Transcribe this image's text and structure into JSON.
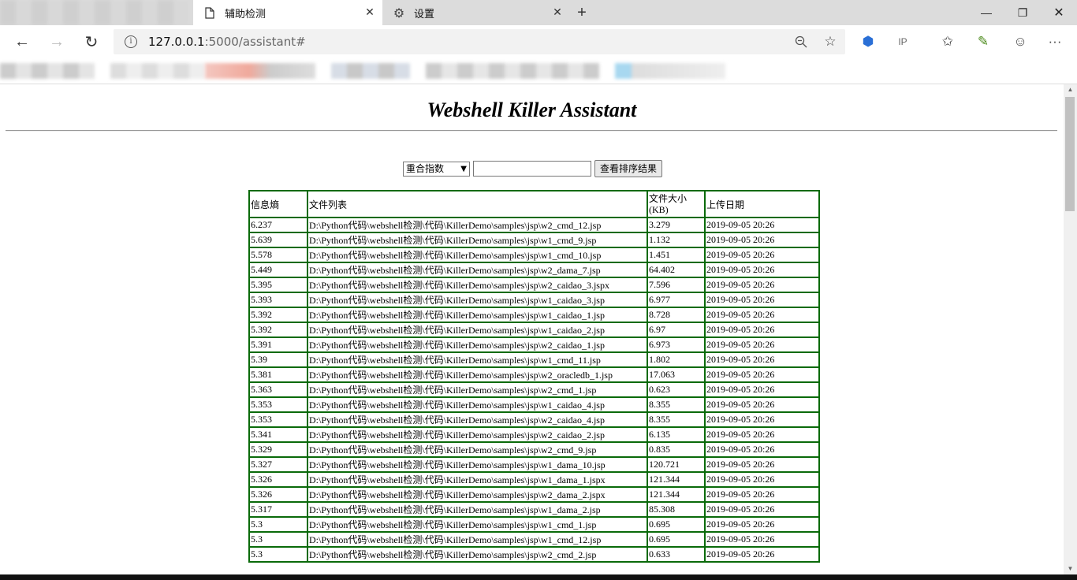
{
  "browser": {
    "tabs": [
      {
        "label": "辅助检测",
        "icon": "page-icon",
        "active": true
      },
      {
        "label": "设置",
        "icon": "gear-icon",
        "active": false
      }
    ],
    "url_host": "127.0.0.1",
    "url_rest": ":5000/assistant#"
  },
  "page": {
    "title": "Webshell Killer Assistant",
    "sort_select": {
      "selected": "重合指数"
    },
    "search_value": "",
    "view_button": "查看排序结果",
    "table": {
      "headers": [
        "信息熵",
        "文件列表",
        "文件大小(KB)",
        "上传日期"
      ],
      "rows": [
        [
          "6.237",
          "D:\\Python代码\\webshell检测\\代码\\KillerDemo\\samples\\jsp\\w2_cmd_12.jsp",
          "3.279",
          "2019-09-05 20:26"
        ],
        [
          "5.639",
          "D:\\Python代码\\webshell检测\\代码\\KillerDemo\\samples\\jsp\\w1_cmd_9.jsp",
          "1.132",
          "2019-09-05 20:26"
        ],
        [
          "5.578",
          "D:\\Python代码\\webshell检测\\代码\\KillerDemo\\samples\\jsp\\w1_cmd_10.jsp",
          "1.451",
          "2019-09-05 20:26"
        ],
        [
          "5.449",
          "D:\\Python代码\\webshell检测\\代码\\KillerDemo\\samples\\jsp\\w2_dama_7.jsp",
          "64.402",
          "2019-09-05 20:26"
        ],
        [
          "5.395",
          "D:\\Python代码\\webshell检测\\代码\\KillerDemo\\samples\\jsp\\w2_caidao_3.jspx",
          "7.596",
          "2019-09-05 20:26"
        ],
        [
          "5.393",
          "D:\\Python代码\\webshell检测\\代码\\KillerDemo\\samples\\jsp\\w1_caidao_3.jsp",
          "6.977",
          "2019-09-05 20:26"
        ],
        [
          "5.392",
          "D:\\Python代码\\webshell检测\\代码\\KillerDemo\\samples\\jsp\\w1_caidao_1.jsp",
          "8.728",
          "2019-09-05 20:26"
        ],
        [
          "5.392",
          "D:\\Python代码\\webshell检测\\代码\\KillerDemo\\samples\\jsp\\w1_caidao_2.jsp",
          "6.97",
          "2019-09-05 20:26"
        ],
        [
          "5.391",
          "D:\\Python代码\\webshell检测\\代码\\KillerDemo\\samples\\jsp\\w2_caidao_1.jsp",
          "6.973",
          "2019-09-05 20:26"
        ],
        [
          "5.39",
          "D:\\Python代码\\webshell检测\\代码\\KillerDemo\\samples\\jsp\\w1_cmd_11.jsp",
          "1.802",
          "2019-09-05 20:26"
        ],
        [
          "5.381",
          "D:\\Python代码\\webshell检测\\代码\\KillerDemo\\samples\\jsp\\w2_oracledb_1.jsp",
          "17.063",
          "2019-09-05 20:26"
        ],
        [
          "5.363",
          "D:\\Python代码\\webshell检测\\代码\\KillerDemo\\samples\\jsp\\w2_cmd_1.jsp",
          "0.623",
          "2019-09-05 20:26"
        ],
        [
          "5.353",
          "D:\\Python代码\\webshell检测\\代码\\KillerDemo\\samples\\jsp\\w1_caidao_4.jsp",
          "8.355",
          "2019-09-05 20:26"
        ],
        [
          "5.353",
          "D:\\Python代码\\webshell检测\\代码\\KillerDemo\\samples\\jsp\\w2_caidao_4.jsp",
          "8.355",
          "2019-09-05 20:26"
        ],
        [
          "5.341",
          "D:\\Python代码\\webshell检测\\代码\\KillerDemo\\samples\\jsp\\w2_caidao_2.jsp",
          "6.135",
          "2019-09-05 20:26"
        ],
        [
          "5.329",
          "D:\\Python代码\\webshell检测\\代码\\KillerDemo\\samples\\jsp\\w2_cmd_9.jsp",
          "0.835",
          "2019-09-05 20:26"
        ],
        [
          "5.327",
          "D:\\Python代码\\webshell检测\\代码\\KillerDemo\\samples\\jsp\\w1_dama_10.jsp",
          "120.721",
          "2019-09-05 20:26"
        ],
        [
          "5.326",
          "D:\\Python代码\\webshell检测\\代码\\KillerDemo\\samples\\jsp\\w1_dama_1.jspx",
          "121.344",
          "2019-09-05 20:26"
        ],
        [
          "5.326",
          "D:\\Python代码\\webshell检测\\代码\\KillerDemo\\samples\\jsp\\w2_dama_2.jspx",
          "121.344",
          "2019-09-05 20:26"
        ],
        [
          "5.317",
          "D:\\Python代码\\webshell检测\\代码\\KillerDemo\\samples\\jsp\\w1_dama_2.jsp",
          "85.308",
          "2019-09-05 20:26"
        ],
        [
          "5.3",
          "D:\\Python代码\\webshell检测\\代码\\KillerDemo\\samples\\jsp\\w1_cmd_1.jsp",
          "0.695",
          "2019-09-05 20:26"
        ],
        [
          "5.3",
          "D:\\Python代码\\webshell检测\\代码\\KillerDemo\\samples\\jsp\\w1_cmd_12.jsp",
          "0.695",
          "2019-09-05 20:26"
        ],
        [
          "5.3",
          "D:\\Python代码\\webshell检测\\代码\\KillerDemo\\samples\\jsp\\w2_cmd_2.jsp",
          "0.633",
          "2019-09-05 20:26"
        ]
      ]
    }
  },
  "colors": {
    "table_border": "#0a6a0a",
    "tab_bar": "#dcdcdc"
  }
}
